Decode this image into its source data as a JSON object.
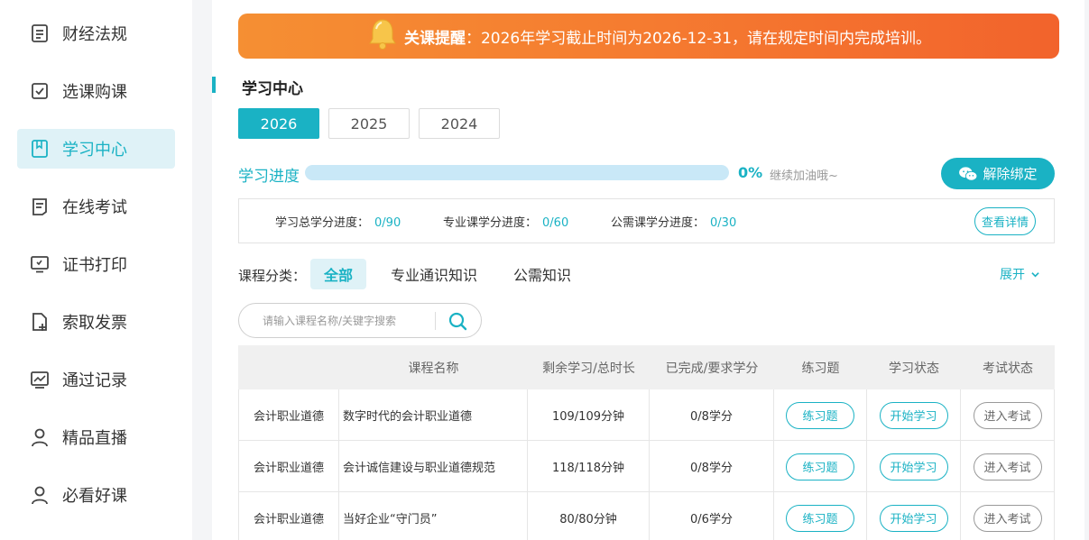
{
  "sidebar": {
    "items": [
      {
        "label": "财经法规",
        "icon": "document-icon"
      },
      {
        "label": "选课购课",
        "icon": "checkbox-icon"
      },
      {
        "label": "学习中心",
        "icon": "book-icon",
        "active": true
      },
      {
        "label": "在线考试",
        "icon": "exam-paper-icon"
      },
      {
        "label": "证书打印",
        "icon": "monitor-icon"
      },
      {
        "label": "索取发票",
        "icon": "file-add-icon"
      },
      {
        "label": "通过记录",
        "icon": "chart-record-icon"
      },
      {
        "label": "精品直播",
        "icon": "user-icon"
      },
      {
        "label": "必看好课",
        "icon": "user-icon"
      }
    ]
  },
  "notice": {
    "prefix": "关课提醒",
    "text": "：2026年学习截止时间为2026-12-31，请在规定时间内完成培训。"
  },
  "section_title": "学习中心",
  "years": [
    {
      "label": "2026",
      "active": true
    },
    {
      "label": "2025",
      "active": false
    },
    {
      "label": "2024",
      "active": false
    }
  ],
  "progress": {
    "label": "学习进度",
    "percent_text": "0%",
    "percent_value": 0,
    "hint": "继续加油哦~"
  },
  "unbind_label": "解除绑定",
  "credits": {
    "total_label": "学习总学分进度：",
    "total_value": "0/90",
    "pro_label": "专业课学分进度：",
    "pro_value": "0/60",
    "pub_label": "公需课学分进度：",
    "pub_value": "0/30",
    "detail_label": "查看详情"
  },
  "category": {
    "label": "课程分类：",
    "tabs": [
      "全部",
      "专业通识知识",
      "公需知识"
    ],
    "expand_label": "展开"
  },
  "search": {
    "placeholder": "请输入课程名称/关键字搜索"
  },
  "table": {
    "headers": [
      "课程名称",
      "剩余学习/总时长",
      "已完成/要求学分",
      "练习题",
      "学习状态",
      "考试状态"
    ],
    "rows": [
      {
        "category": "会计职业道德",
        "name": "数字时代的会计职业道德",
        "time": "109/109分钟",
        "credit": "0/8学分",
        "practice": "练习题",
        "study": "开始学习",
        "exam": "进入考试"
      },
      {
        "category": "会计职业道德",
        "name": "会计诚信建设与职业道德规范",
        "time": "118/118分钟",
        "credit": "0/8学分",
        "practice": "练习题",
        "study": "开始学习",
        "exam": "进入考试"
      },
      {
        "category": "会计职业道德",
        "name": "当好企业“守门员”",
        "time": "80/80分钟",
        "credit": "0/6学分",
        "practice": "练习题",
        "study": "开始学习",
        "exam": "进入考试"
      }
    ]
  },
  "colors": {
    "accent": "#1ab2c4",
    "notice_start": "#f58f33",
    "notice_end": "#f2632c",
    "progress_track": "#c9e8f7"
  }
}
